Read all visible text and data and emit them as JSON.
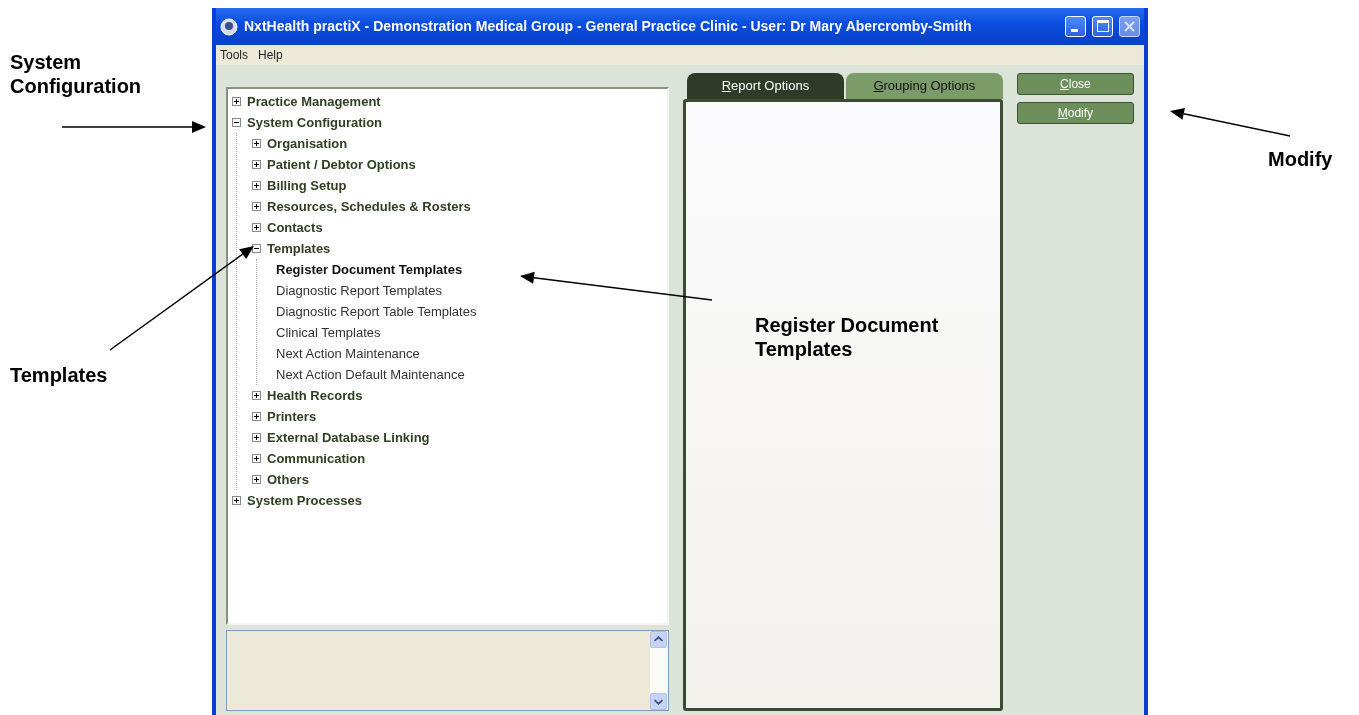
{
  "window": {
    "title": "NxtHealth practiX - Demonstration Medical Group - General Practice Clinic - User: Dr Mary Abercromby-Smith"
  },
  "menu": [
    "Tools",
    "Help"
  ],
  "tree": [
    {
      "label": "Practice Management",
      "expanded": false,
      "selected": false
    },
    {
      "label": "System Configuration",
      "expanded": true,
      "selected": false,
      "children": [
        {
          "label": "Organisation",
          "expanded": false,
          "selected": false
        },
        {
          "label": "Patient / Debtor Options",
          "expanded": false,
          "selected": false
        },
        {
          "label": "Billing Setup",
          "expanded": false,
          "selected": false
        },
        {
          "label": "Resources, Schedules & Rosters",
          "expanded": false,
          "selected": false
        },
        {
          "label": "Contacts",
          "expanded": false,
          "selected": false
        },
        {
          "label": "Templates",
          "expanded": true,
          "selected": false,
          "children": [
            {
              "label": "Register Document Templates",
              "selected": true
            },
            {
              "label": "Diagnostic Report Templates",
              "selected": false
            },
            {
              "label": "Diagnostic Report Table Templates",
              "selected": false
            },
            {
              "label": "Clinical Templates",
              "selected": false
            },
            {
              "label": "Next Action Maintenance",
              "selected": false
            },
            {
              "label": "Next Action Default Maintenance",
              "selected": false
            }
          ]
        },
        {
          "label": "Health Records",
          "expanded": false,
          "selected": false
        },
        {
          "label": "Printers",
          "expanded": false,
          "selected": false
        },
        {
          "label": "External Database Linking",
          "expanded": false,
          "selected": false
        },
        {
          "label": "Communication",
          "expanded": false,
          "selected": false
        },
        {
          "label": "Others",
          "expanded": false,
          "selected": false
        }
      ]
    },
    {
      "label": "System Processes",
      "expanded": false,
      "selected": false
    }
  ],
  "tabs": [
    {
      "label": "Report Options",
      "selected": true
    },
    {
      "label": "Grouping Options",
      "selected": false
    }
  ],
  "buttons": [
    "Close",
    "Modify"
  ],
  "annotations": [
    {
      "text": "System Configuration"
    },
    {
      "text": "Templates"
    },
    {
      "text": "Register Document Templates"
    },
    {
      "text": "Modify"
    }
  ]
}
